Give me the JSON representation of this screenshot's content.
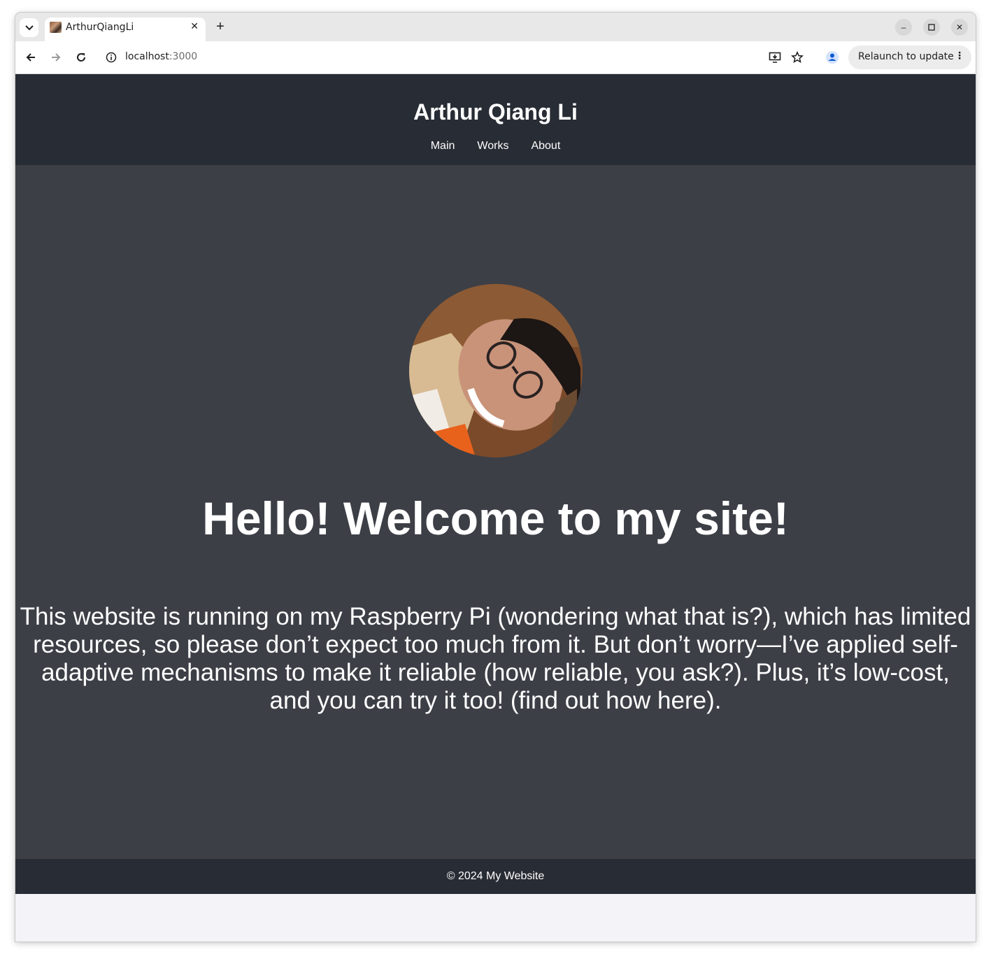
{
  "browser": {
    "tab_title": "ArthurQiangLi",
    "url_host": "localhost",
    "url_port": ":3000",
    "relaunch_label": "Relaunch to update"
  },
  "site": {
    "title": "Arthur Qiang Li",
    "nav": [
      "Main",
      "Works",
      "About"
    ],
    "heading": "Hello! Welcome to my site!",
    "intro": "This website is running on my Raspberry Pi (wondering what that is?), which has limited resources, so please don’t expect too much from it. But don’t worry—I’ve applied self-adaptive mechanisms to make it reliable (how reliable, you ask?). Plus, it’s low-cost, and you can try it too! (find out how here).",
    "footer": "© 2024 My Website"
  },
  "colors": {
    "header_bg": "#282c34",
    "main_bg": "#3c3f46",
    "page_bg": "#f3f3f8"
  },
  "icons": [
    "tab-search-icon",
    "favicon",
    "close-icon",
    "plus-icon",
    "minimize-icon",
    "maximize-icon",
    "back-icon",
    "forward-icon",
    "reload-icon",
    "info-icon",
    "install-icon",
    "star-icon",
    "profile-icon",
    "kebab-menu-icon"
  ]
}
